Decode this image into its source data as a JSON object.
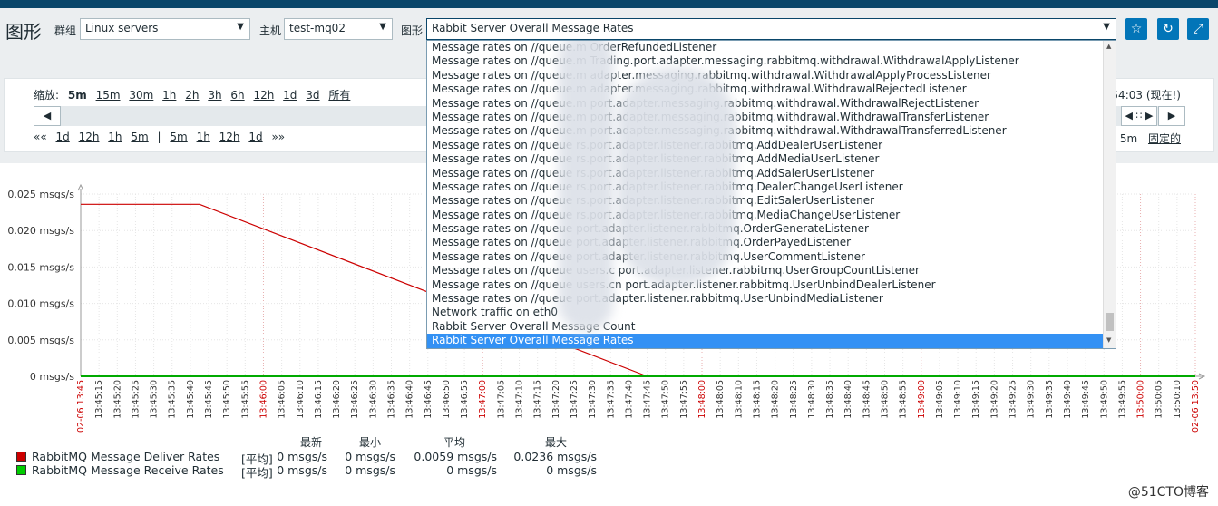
{
  "header": {
    "title": "图形",
    "group_label": "群组",
    "group_value": "Linux servers",
    "host_label": "主机",
    "host_value": "test-mq02",
    "graph_label": "图形",
    "graph_value": "Rabbit Server Overall Message Rates"
  },
  "filter": {
    "zoom_label": "缩放:",
    "zoom_options": [
      "5m",
      "15m",
      "30m",
      "1h",
      "2h",
      "3h",
      "6h",
      "12h",
      "1d",
      "3d",
      "所有"
    ],
    "zoom_current": "5m",
    "timestamp": "54:03 (现在!)",
    "nav_back": "«« ",
    "nav_back_items": [
      "1d",
      "12h",
      "1h",
      "5m"
    ],
    "nav_sep": "|",
    "nav_fwd_items": [
      "5m",
      "1h",
      "12h",
      "1d"
    ],
    "nav_fwd": "»»",
    "left_btn": "◀",
    "right_btn": "▶",
    "zoom_btn": "◀ ∷ ▶",
    "period": "5m",
    "fixed": "固定的"
  },
  "dropdown": {
    "items": [
      "Message rates on //queue.m                                    OrderRefundedListener",
      "Message rates on //queue.m                 Trading.port.adapter.messaging.rabbitmq.withdrawal.WithdrawalApplyListener",
      "Message rates on //queue.m                    adapter.messaging.rabbitmq.withdrawal.WithdrawalApplyProcessListener",
      "Message rates on //queue.m                    adapter.messaging.rabbitmq.withdrawal.WithdrawalRejectedListener",
      "Message rates on //queue.m                    port.adapter.messaging.rabbitmq.withdrawal.WithdrawalRejectListener",
      "Message rates on //queue.m                    port.adapter.messaging.rabbitmq.withdrawal.WithdrawalTransferListener",
      "Message rates on //queue.m                    port.adapter.messaging.rabbitmq.withdrawal.WithdrawalTransferredListener",
      "Message rates on //queue                    rs.port.adapter.listener.rabbitmq.AddDealerUserListener",
      "Message rates on //queue                    rs.port.adapter.listener.rabbitmq.AddMediaUserListener",
      "Message rates on //queue                    rs.port.adapter.listener.rabbitmq.AddSalerUserListener",
      "Message rates on //queue                    rs.port.adapter.listener.rabbitmq.DealerChangeUserListener",
      "Message rates on //queue                    rs.port.adapter.listener.rabbitmq.EditSalerUserListener",
      "Message rates on //queue                    rs.port.adapter.listener.rabbitmq.MediaChangeUserListener",
      "Message rates on //queue                    port.adapter.listener.rabbitmq.OrderGenerateListener",
      "Message rates on //queue                    port.adapter.listener.rabbitmq.OrderPayedListener",
      "Message rates on //queue                    port.adapter.listener.rabbitmq.UserCommentListener",
      "Message rates on //queue    users.c       port.adapter.listener.rabbitmq.UserGroupCountListener",
      "Message rates on //queue    users.cn      port.adapter.listener.rabbitmq.UserUnbindDealerListener",
      "Message rates on //queue                  port.adapter.listener.rabbitmq.UserUnbindMediaListener",
      "Network traffic on eth0",
      "Rabbit Server Overall Message Count",
      "Rabbit Server Overall Message Rates"
    ],
    "selected_index": 21,
    "scroll_up": "▲",
    "scroll_down": "▼"
  },
  "chart_data": {
    "type": "line",
    "y_unit": "msgs/s",
    "y_ticks": [
      "0 msgs/s",
      "0.005 msgs/s",
      "0.010 msgs/s",
      "0.015 msgs/s",
      "0.020 msgs/s",
      "0.025 msgs/s"
    ],
    "ylim": [
      0,
      0.025
    ],
    "x_ticks": [
      "02-06 13:45",
      "13:45:15",
      "13:45:20",
      "13:45:25",
      "13:45:30",
      "13:45:35",
      "13:45:40",
      "13:45:45",
      "13:45:50",
      "13:45:55",
      "13:46:00",
      "13:46:05",
      "13:46:10",
      "13:46:15",
      "13:46:20",
      "13:46:25",
      "13:46:30",
      "13:46:35",
      "13:46:40",
      "13:46:45",
      "13:46:50",
      "13:46:55",
      "13:47:00",
      "13:47:05",
      "13:47:10",
      "13:47:15",
      "13:47:20",
      "13:47:25",
      "13:47:30",
      "13:47:35",
      "13:47:40",
      "13:47:45",
      "13:47:50",
      "13:47:55",
      "13:48:00",
      "13:48:05",
      "13:48:10",
      "13:48:15",
      "13:48:20",
      "13:48:25",
      "13:48:30",
      "13:48:35",
      "13:48:40",
      "13:48:45",
      "13:48:50",
      "13:48:55",
      "13:49:00",
      "13:49:05",
      "13:49:10",
      "13:49:15",
      "13:49:20",
      "13:49:25",
      "13:49:30",
      "13:49:35",
      "13:49:40",
      "13:49:45",
      "13:49:50",
      "13:49:55",
      "13:50:00",
      "13:50:05",
      "13:50:10",
      "02-06 13:50"
    ],
    "x_ticks_red": [
      "02-06 13:45",
      "13:46:00",
      "13:47:00",
      "13:48:00",
      "13:49:00",
      "13:50:00",
      "02-06 13:50"
    ],
    "series": [
      {
        "name": "RabbitMQ Message Deliver Rates",
        "color": "#cc0000",
        "points": [
          [
            0,
            0.0236
          ],
          [
            6.5,
            0.0236
          ],
          [
            31,
            0
          ]
        ]
      },
      {
        "name": "RabbitMQ Message Receive Rates",
        "color": "#00aa00",
        "points": [
          [
            0,
            0
          ],
          [
            61,
            0
          ]
        ]
      }
    ],
    "legend": {
      "headers": [
        "最新",
        "最小",
        "平均",
        "最大"
      ],
      "rows": [
        {
          "name": "RabbitMQ Message Deliver Rates",
          "tag": "[平均]",
          "color": "#cc0000",
          "last": "0 msgs/s",
          "min": "0 msgs/s",
          "avg": "0.0059 msgs/s",
          "max": "0.0236 msgs/s"
        },
        {
          "name": "RabbitMQ Message Receive Rates",
          "tag": "[平均]",
          "color": "#00cc00",
          "last": "0 msgs/s",
          "min": "0 msgs/s",
          "avg": "0 msgs/s",
          "max": "0 msgs/s"
        }
      ]
    }
  },
  "watermark": "@51CTO博客"
}
